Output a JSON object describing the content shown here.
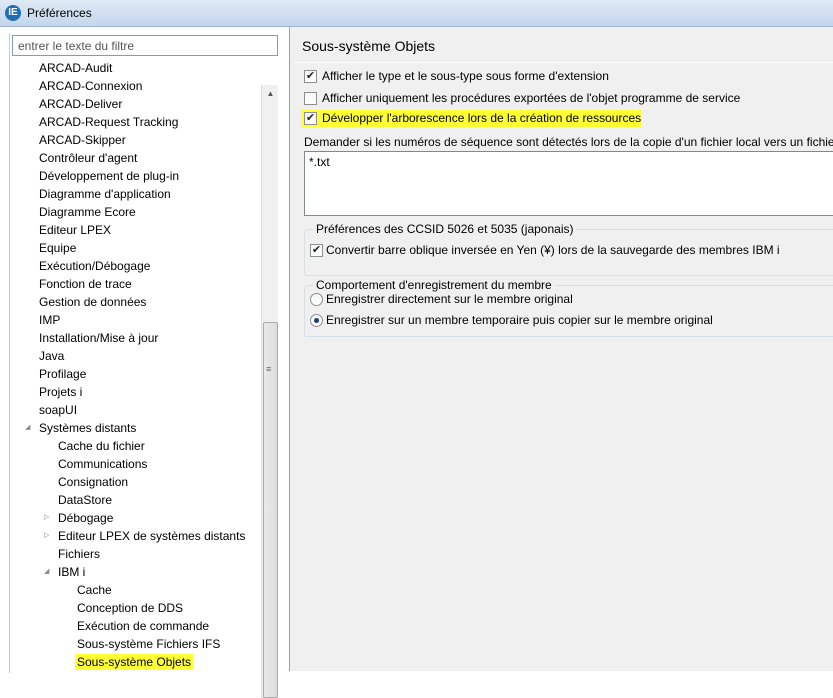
{
  "window": {
    "title": "Préférences"
  },
  "filter": {
    "placeholder": "entrer le texte du filtre"
  },
  "tree": {
    "items": [
      {
        "label": "ARCAD-Audit",
        "level": 0,
        "expander": "none"
      },
      {
        "label": "ARCAD-Connexion",
        "level": 0,
        "expander": "none"
      },
      {
        "label": "ARCAD-Deliver",
        "level": 0,
        "expander": "none"
      },
      {
        "label": "ARCAD-Request Tracking",
        "level": 0,
        "expander": "none"
      },
      {
        "label": "ARCAD-Skipper",
        "level": 0,
        "expander": "none"
      },
      {
        "label": "Contrôleur d'agent",
        "level": 0,
        "expander": "none"
      },
      {
        "label": "Développement de plug-in",
        "level": 0,
        "expander": "none"
      },
      {
        "label": "Diagramme d'application",
        "level": 0,
        "expander": "none"
      },
      {
        "label": "Diagramme Ecore",
        "level": 0,
        "expander": "none"
      },
      {
        "label": "Editeur LPEX",
        "level": 0,
        "expander": "none"
      },
      {
        "label": "Equipe",
        "level": 0,
        "expander": "none"
      },
      {
        "label": "Exécution/Débogage",
        "level": 0,
        "expander": "none"
      },
      {
        "label": "Fonction de trace",
        "level": 0,
        "expander": "none"
      },
      {
        "label": "Gestion de données",
        "level": 0,
        "expander": "none"
      },
      {
        "label": "IMP",
        "level": 0,
        "expander": "none"
      },
      {
        "label": "Installation/Mise à jour",
        "level": 0,
        "expander": "none"
      },
      {
        "label": "Java",
        "level": 0,
        "expander": "none"
      },
      {
        "label": "Profilage",
        "level": 0,
        "expander": "none"
      },
      {
        "label": "Projets i",
        "level": 0,
        "expander": "none"
      },
      {
        "label": "soapUI",
        "level": 0,
        "expander": "none"
      },
      {
        "label": "Systèmes distants",
        "level": 0,
        "expander": "expanded"
      },
      {
        "label": "Cache du fichier",
        "level": 1,
        "expander": "none"
      },
      {
        "label": "Communications",
        "level": 1,
        "expander": "none"
      },
      {
        "label": "Consignation",
        "level": 1,
        "expander": "none"
      },
      {
        "label": "DataStore",
        "level": 1,
        "expander": "none"
      },
      {
        "label": "Débogage",
        "level": 1,
        "expander": "collapsed"
      },
      {
        "label": "Editeur LPEX de systèmes distants",
        "level": 1,
        "expander": "collapsed"
      },
      {
        "label": "Fichiers",
        "level": 1,
        "expander": "none"
      },
      {
        "label": "IBM i",
        "level": 1,
        "expander": "expanded"
      },
      {
        "label": "Cache",
        "level": 2,
        "expander": "none"
      },
      {
        "label": "Conception de DDS",
        "level": 2,
        "expander": "none"
      },
      {
        "label": "Exécution de commande",
        "level": 2,
        "expander": "none"
      },
      {
        "label": "Sous-système Fichiers IFS",
        "level": 2,
        "expander": "none"
      },
      {
        "label": "Sous-système Objets",
        "level": 2,
        "expander": "none",
        "selected": true
      }
    ]
  },
  "page": {
    "title": "Sous-système Objets",
    "options": [
      {
        "label": "Afficher le type et le sous-type sous forme d'extension",
        "checked": true
      },
      {
        "label": "Afficher uniquement les procédures exportées de l'objet programme de service",
        "checked": false
      },
      {
        "label": "Développer l'arborescence lors de la création de ressources",
        "checked": true,
        "highlighted": true
      }
    ],
    "sequence_label": "Demander si les numéros de séquence sont détectés lors de la copie d'un fichier local vers un fichier p",
    "sequence_value": "*.txt",
    "ccsid_group": {
      "title": "Préférences des CCSID 5026 et 5035 (japonais)",
      "option": {
        "label": "Convertir barre oblique inversée en Yen (¥) lors de la sauvegarde des membres IBM i",
        "checked": true
      }
    },
    "save_group": {
      "title": "Comportement d'enregistrement du membre",
      "options": [
        {
          "label": "Enregistrer directement sur le membre original",
          "selected": false
        },
        {
          "label": "Enregistrer sur un membre temporaire puis copier sur le membre original",
          "selected": true
        }
      ]
    }
  }
}
